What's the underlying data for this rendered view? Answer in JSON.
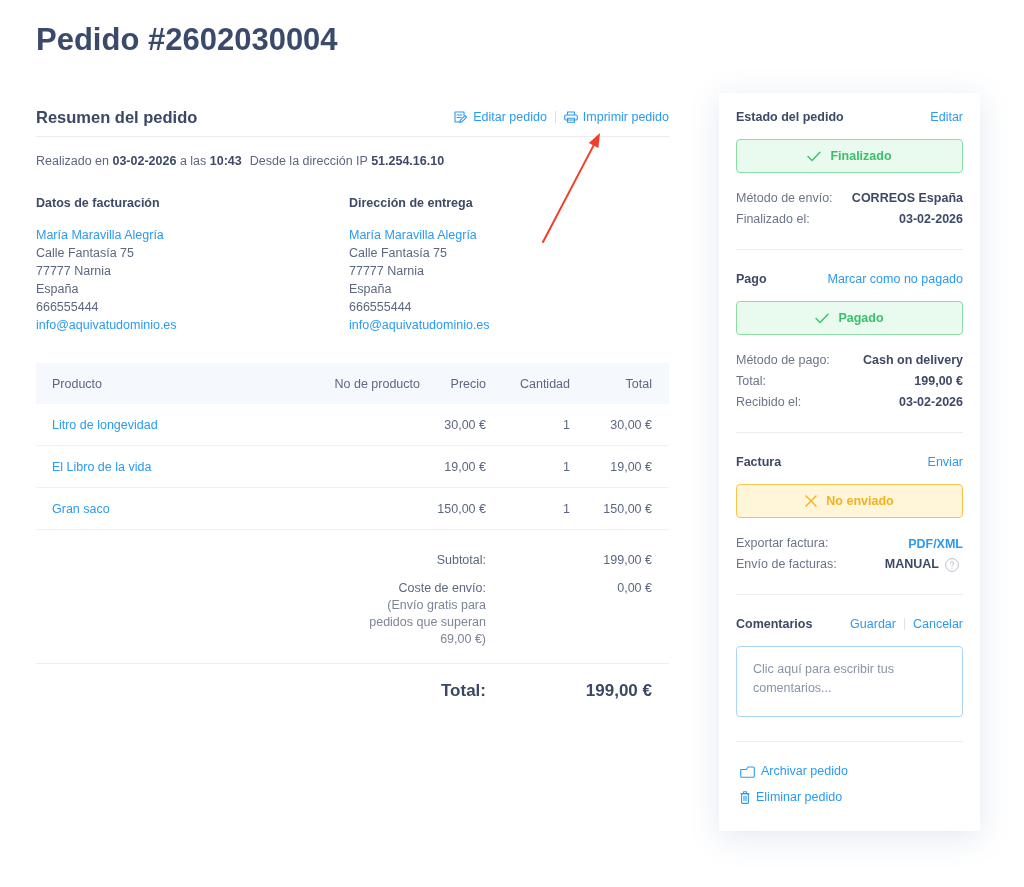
{
  "title": "Pedido #2602030004",
  "summary": {
    "heading": "Resumen del pedido",
    "actions": [
      "Editar pedido",
      "Imprimir pedido"
    ],
    "placed": "Realizado en **03-02-2026** a las **10:43**",
    "ip": "Desde la dirección IP **51.254.16.10**"
  },
  "addresses": [
    {
      "heading": "Datos de facturación",
      "name": "María Maravilla Alegría",
      "lines": [
        "Calle Fantasía 75",
        "77777 Narnia",
        "España",
        "666555444"
      ],
      "email": "info@aquivatudominio.es"
    },
    {
      "heading": "Dirección de entrega",
      "name": "María Maravilla Alegría",
      "lines": [
        "Calle Fantasía 75",
        "77777 Narnia",
        "España",
        "666555444"
      ],
      "email": "info@aquivatudominio.es"
    }
  ],
  "table": {
    "columns": [
      "Producto",
      "No de producto",
      "Precio",
      "Cantidad",
      "Total"
    ],
    "rows": [
      {
        "product": "Litro de longevidad",
        "price": "30,00 €",
        "quantity": "1",
        "total": "30,00 €"
      },
      {
        "product": "El Libro de la vida",
        "price": "19,00 €",
        "quantity": "1",
        "total": "19,00 €"
      },
      {
        "product": "Gran saco",
        "price": "150,00 €",
        "quantity": "1",
        "total": "150,00 €"
      }
    ]
  },
  "totals": {
    "subtotal": {
      "label": "Subtotal:",
      "value": "199,00 €"
    },
    "shipping": {
      "label": "Coste de envío:",
      "note": "(Envío gratis para pedidos que superan 69,00 €)",
      "value": "0,00 €"
    },
    "total": {
      "label": "Total:",
      "value": "199,00 €"
    }
  },
  "sidebar": {
    "sections": [
      {
        "title": "Estado del pedido",
        "actions": [
          "Editar"
        ],
        "status": {
          "kind": "success",
          "label": "Finalizado"
        },
        "rows": [
          {
            "kind": "text",
            "label": "Método de envío:",
            "value": "CORREOS España"
          },
          {
            "kind": "text",
            "label": "Finalizado el:",
            "value": "03-02-2026"
          }
        ]
      },
      {
        "title": "Pago",
        "actions": [
          "Marcar como no pagado"
        ],
        "status": {
          "kind": "success",
          "label": "Pagado"
        },
        "rows": [
          {
            "kind": "text",
            "label": "Método de pago:",
            "value": "Cash on delivery"
          },
          {
            "kind": "text",
            "label": "Total:",
            "value": "199,00 €"
          },
          {
            "kind": "text",
            "label": "Recibido el:",
            "value": "03-02-2026"
          }
        ]
      },
      {
        "title": "Factura",
        "actions": [
          "Enviar"
        ],
        "status": {
          "kind": "warning",
          "label": "No enviado"
        },
        "rows": [
          {
            "kind": "link",
            "label": "Exportar factura:",
            "value": "PDF/XML"
          },
          {
            "kind": "help",
            "label": "Envío de facturas:",
            "value": "MANUAL"
          }
        ]
      },
      {
        "title": "Comentarios",
        "actions": [
          "Guardar",
          "Cancelar"
        ],
        "comment": {
          "placeholder": "Clic aquí para escribir tus comentarios..."
        }
      }
    ],
    "actions": [
      "Archivar pedido",
      "Eliminar pedido"
    ]
  }
}
